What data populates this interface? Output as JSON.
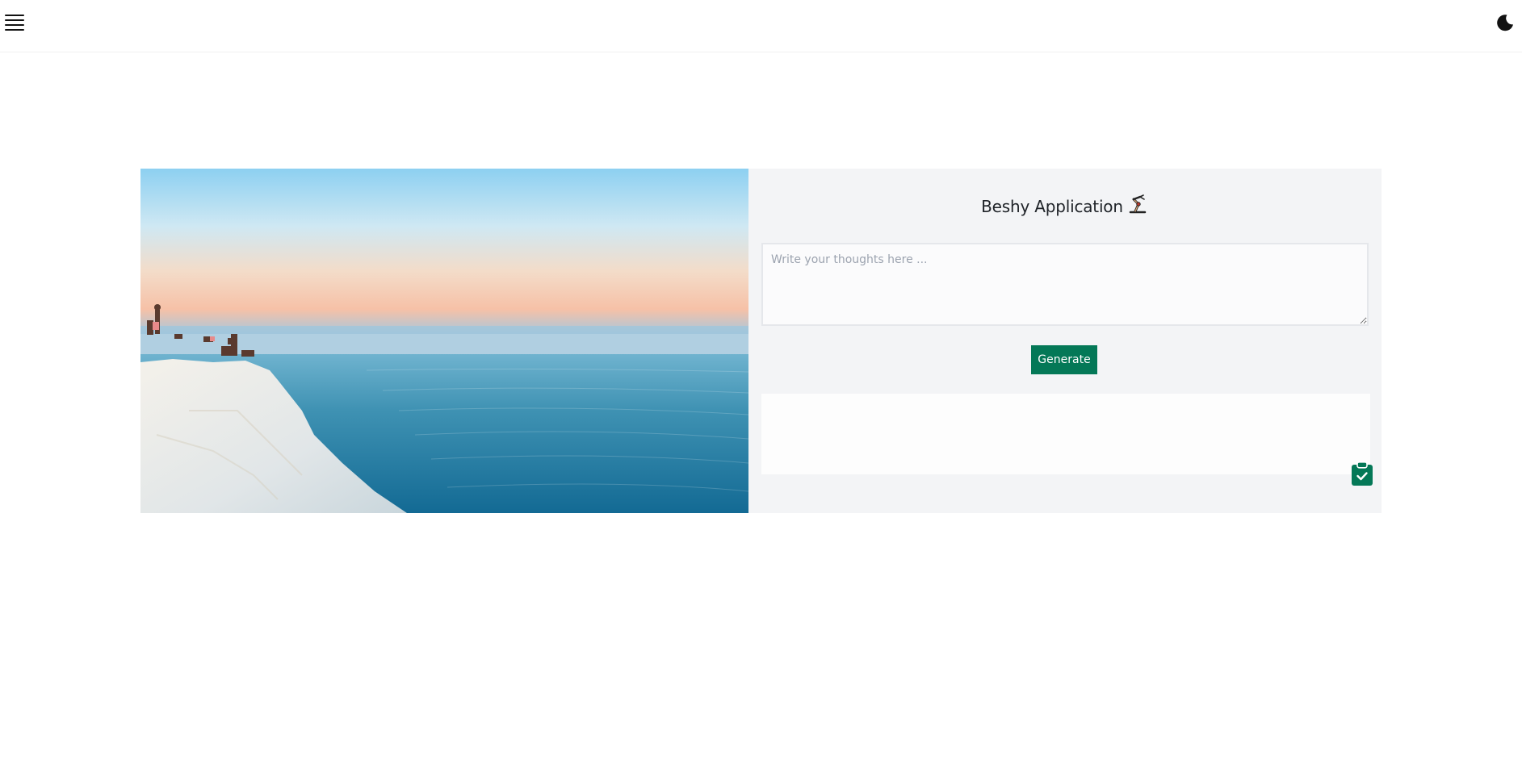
{
  "header": {
    "menu_icon": "hamburger-menu-icon",
    "theme_icon": "moon-icon"
  },
  "main": {
    "title": "Beshy Application",
    "title_icon": "robot-arm-emoji",
    "input": {
      "placeholder": "Write your thoughts here ...",
      "value": ""
    },
    "generate_label": "Generate",
    "output_text": "",
    "copy_icon": "clipboard-check-icon"
  },
  "colors": {
    "accent": "#047857",
    "panel_bg": "#f3f4f6",
    "text": "#1f2328"
  }
}
